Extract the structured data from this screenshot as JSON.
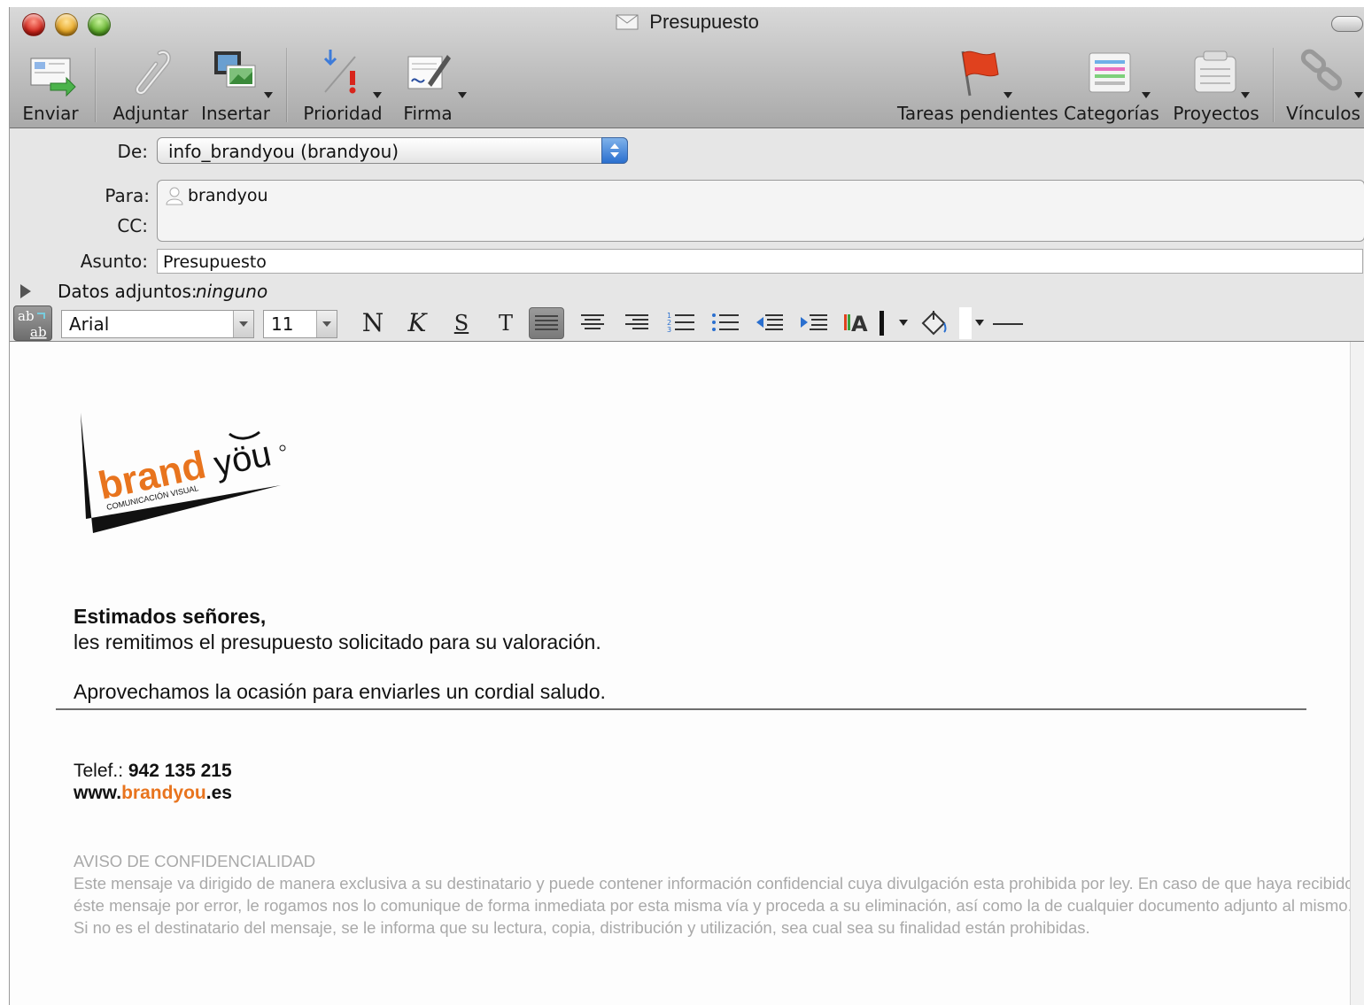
{
  "window": {
    "title": "Presupuesto"
  },
  "toolbar": {
    "items": [
      {
        "id": "send",
        "label": "Enviar",
        "icon": "send-mail-icon"
      },
      {
        "id": "attach",
        "label": "Adjuntar",
        "icon": "paperclip-icon"
      },
      {
        "id": "insert",
        "label": "Insertar",
        "icon": "insert-media-icon"
      },
      {
        "id": "priority",
        "label": "Prioridad",
        "icon": "priority-icon"
      },
      {
        "id": "signature",
        "label": "Firma",
        "icon": "signature-icon"
      },
      {
        "id": "tasks",
        "label": "Tareas pendientes",
        "icon": "flag-icon"
      },
      {
        "id": "categories",
        "label": "Categorías",
        "icon": "categories-icon"
      },
      {
        "id": "projects",
        "label": "Proyectos",
        "icon": "projects-icon"
      },
      {
        "id": "links",
        "label": "Vínculos",
        "icon": "link-chain-icon"
      }
    ]
  },
  "headers": {
    "from_label": "De:",
    "from_value": "info_brandyou (brandyou)",
    "to_label": "Para:",
    "to_recipient": "brandyou",
    "cc_label": "CC:",
    "subject_label": "Asunto:",
    "subject_value": "Presupuesto",
    "attachments_label": "Datos adjuntos:",
    "attachments_value": "ninguno"
  },
  "format_bar": {
    "font": "Arial",
    "size": "11",
    "bold_label": "N",
    "italic_label": "K",
    "underline_label": "S",
    "text_label": "T"
  },
  "message": {
    "logo_text_brand": "brand",
    "logo_text_you": "yöu",
    "logo_tagline": "COMUNICACIÓN VISUAL",
    "greeting": "Estimados señores,",
    "line1": "les remitimos el presupuesto solicitado para su valoración.",
    "line2": "Aprovechamos la ocasión para enviarles un cordial saludo.",
    "phone_label": "Telef.:",
    "phone_value": "942 135 215",
    "web_prefix": "www.",
    "web_brand": "brandyou",
    "web_suffix": ".es",
    "confidential_title": "AVISO DE CONFIDENCIALIDAD",
    "confidential_line1": "Este mensaje va dirigido de manera exclusiva a su destinatario y puede contener información confidencial cuya divulgación esta prohibida por ley. En caso de que haya recibido",
    "confidential_line2": "éste mensaje por error, le rogamos nos lo comunique de forma inmediata por esta misma vía y proceda a su eliminación, así como la de cualquier documento adjunto al mismo.",
    "confidential_line3": "Si no es el destinatario del mensaje, se le informa que su lectura, copia, distribución y utilización, sea cual sea su finalidad están prohibidas."
  },
  "colors": {
    "brand_orange": "#e8741e",
    "selection_blue": "#2a6fcf"
  }
}
